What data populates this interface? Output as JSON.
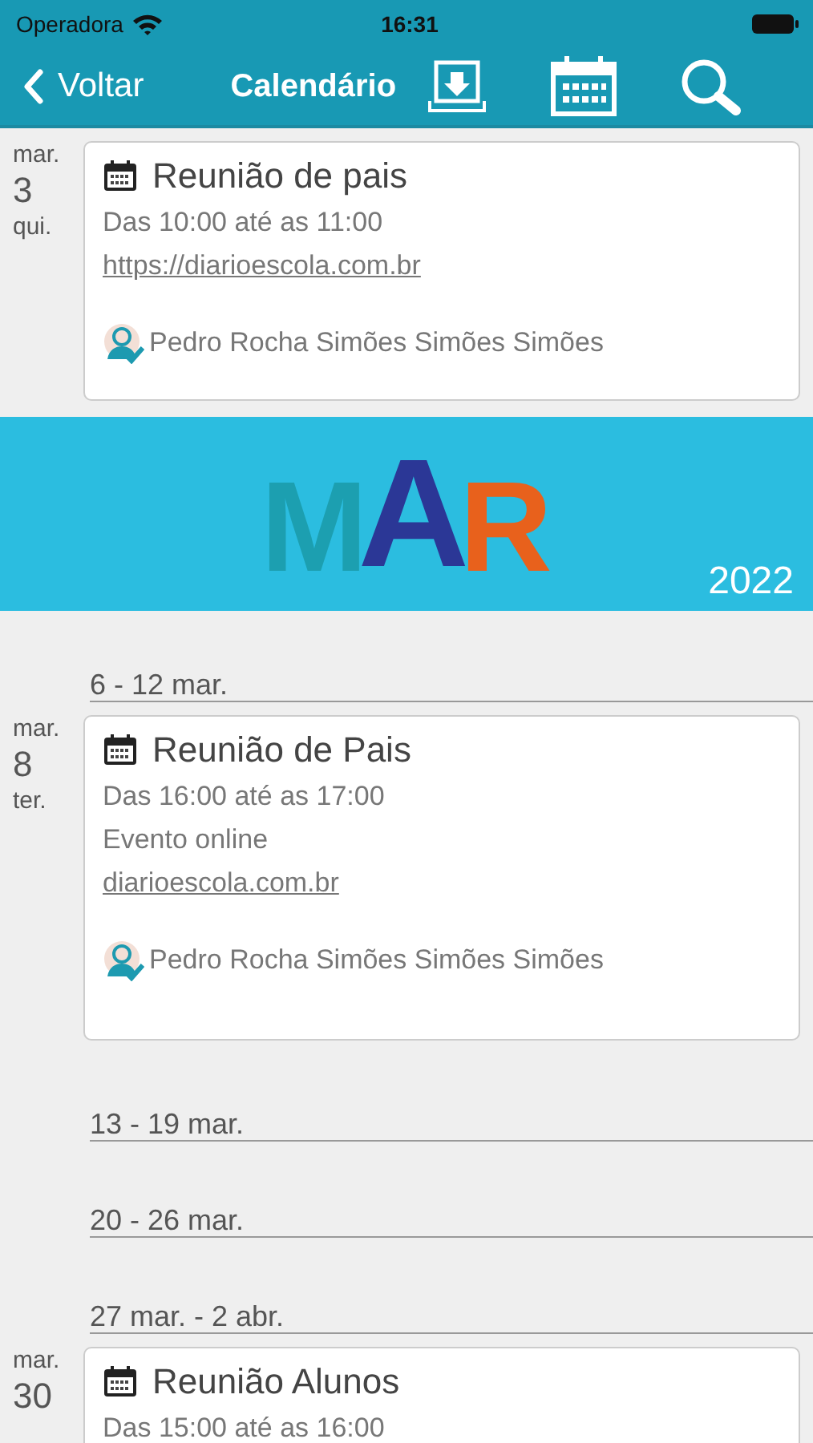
{
  "status_bar": {
    "carrier": "Operadora",
    "time": "16:31"
  },
  "nav": {
    "back": "Voltar",
    "title": "Calendário"
  },
  "items": [
    {
      "kind": "event",
      "month": "mar.",
      "day": "3",
      "weekday": "qui.",
      "title": "Reunião de pais",
      "time": "Das 10:00 até as 11:00",
      "link": "https://diarioescola.com.br",
      "organizer": "Pedro Rocha Simões Simões Simões"
    },
    {
      "kind": "banner",
      "letters": [
        {
          "text": "M",
          "color": "#1c9fb0"
        },
        {
          "text": "A",
          "color": "#2b3796"
        },
        {
          "text": "R",
          "color": "#e8611c"
        }
      ],
      "year": "2022"
    },
    {
      "kind": "week",
      "label": "6 - 12 mar."
    },
    {
      "kind": "event",
      "month": "mar.",
      "day": "8",
      "weekday": "ter.",
      "title": "Reunião de Pais",
      "time": "Das 16:00 até as 17:00",
      "note": "Evento online",
      "link": "diarioescola.com.br",
      "organizer": "Pedro Rocha Simões Simões Simões"
    },
    {
      "kind": "week",
      "label": "13 - 19 mar."
    },
    {
      "kind": "week",
      "label": "20 - 26 mar."
    },
    {
      "kind": "week",
      "label": "27 mar. - 2 abr."
    },
    {
      "kind": "event",
      "month": "mar.",
      "day": "30",
      "title": "Reunião Alunos",
      "time": "Das 15:00 até as 16:00"
    }
  ]
}
